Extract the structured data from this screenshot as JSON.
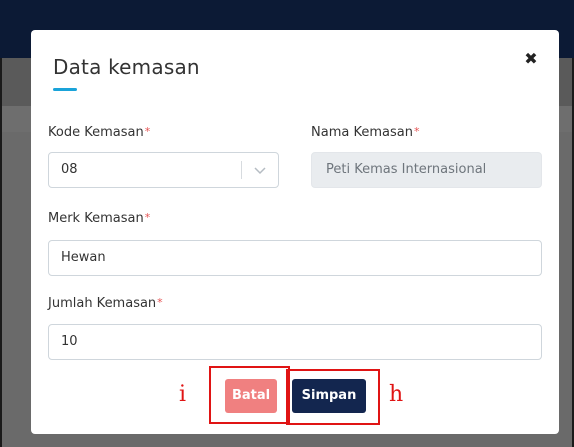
{
  "modal": {
    "title": "Data kemasan",
    "close_glyph": "✖",
    "kode_kemasan": {
      "label": "Kode Kemasan",
      "required_mark": "*",
      "value": "08"
    },
    "nama_kemasan": {
      "label": "Nama Kemasan",
      "required_mark": "*",
      "value": "Peti Kemas Internasional"
    },
    "merk_kemasan": {
      "label": "Merk Kemasan",
      "required_mark": "*",
      "value": "Hewan"
    },
    "jumlah_kemasan": {
      "label": "Jumlah Kemasan",
      "required_mark": "*",
      "value": "10"
    },
    "buttons": {
      "cancel_label": "Batal",
      "save_label": "Simpan"
    }
  },
  "annotations": {
    "cancel_marker": "i",
    "save_marker": "h"
  },
  "colors": {
    "accent": "#1aa3d9",
    "required": "#e55353",
    "cancel_button": "#f08080",
    "save_button": "#13264f",
    "annotation": "#e01414",
    "header_bar": "#0c1a35"
  }
}
